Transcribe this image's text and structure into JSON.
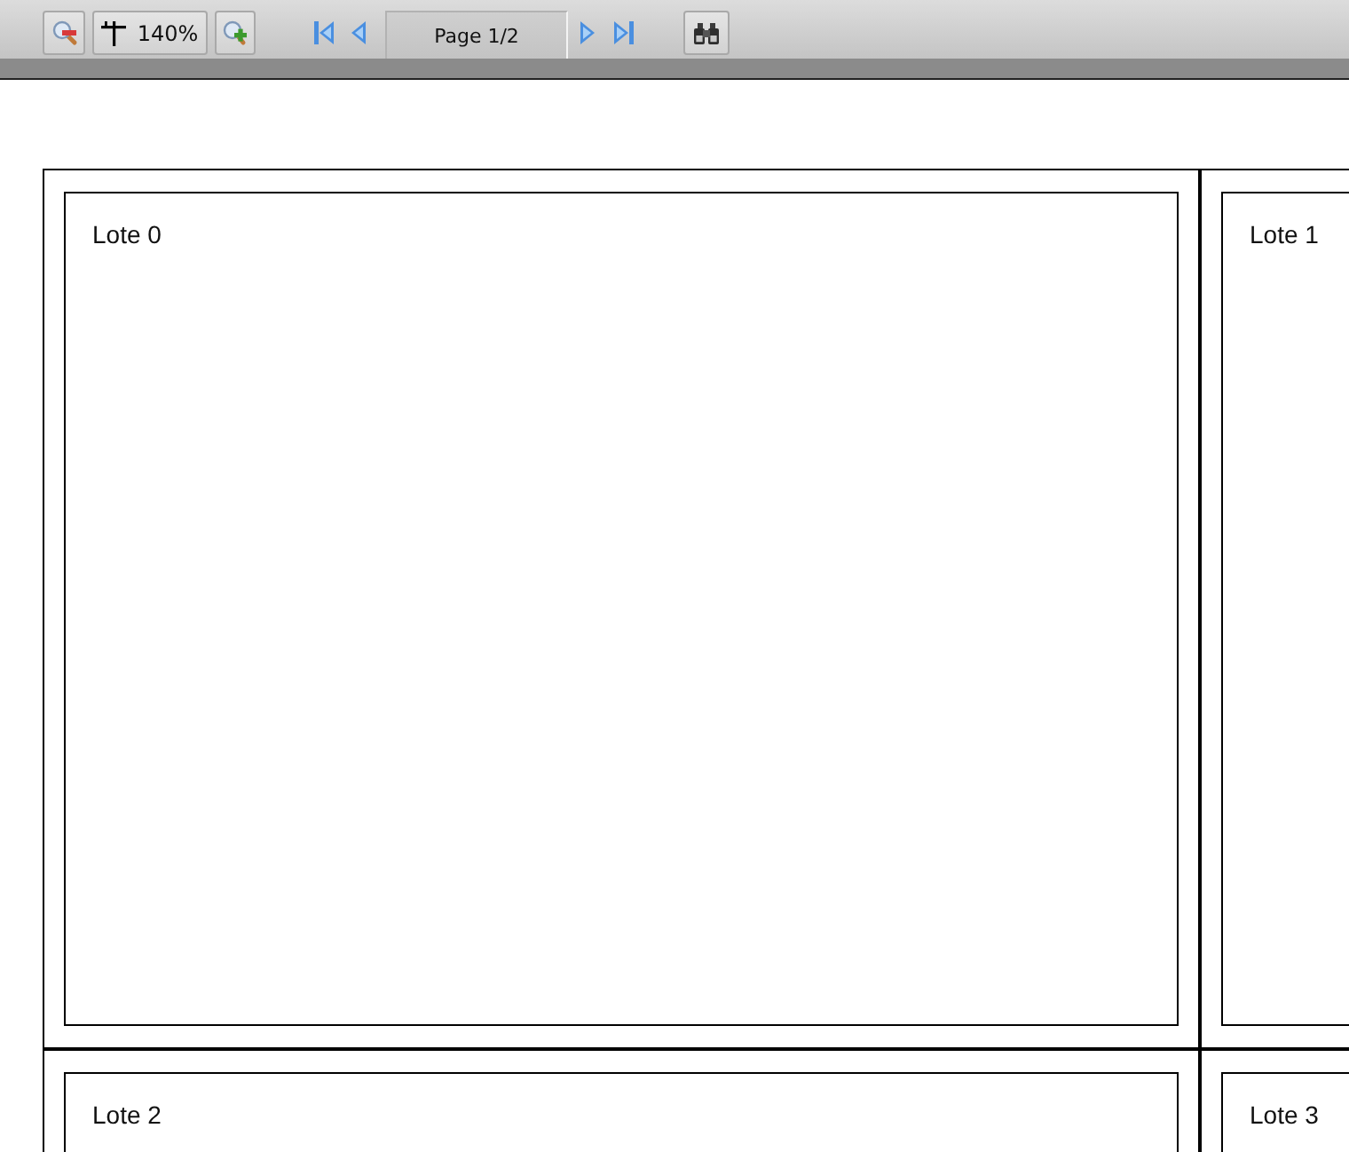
{
  "toolbar": {
    "zoom_level": "140%",
    "page_indicator": "Page 1/2"
  },
  "report": {
    "cells": [
      {
        "label": "Lote 0"
      },
      {
        "label": "Lote 1"
      },
      {
        "label": "Lote 2"
      },
      {
        "label": "Lote 3"
      }
    ]
  }
}
